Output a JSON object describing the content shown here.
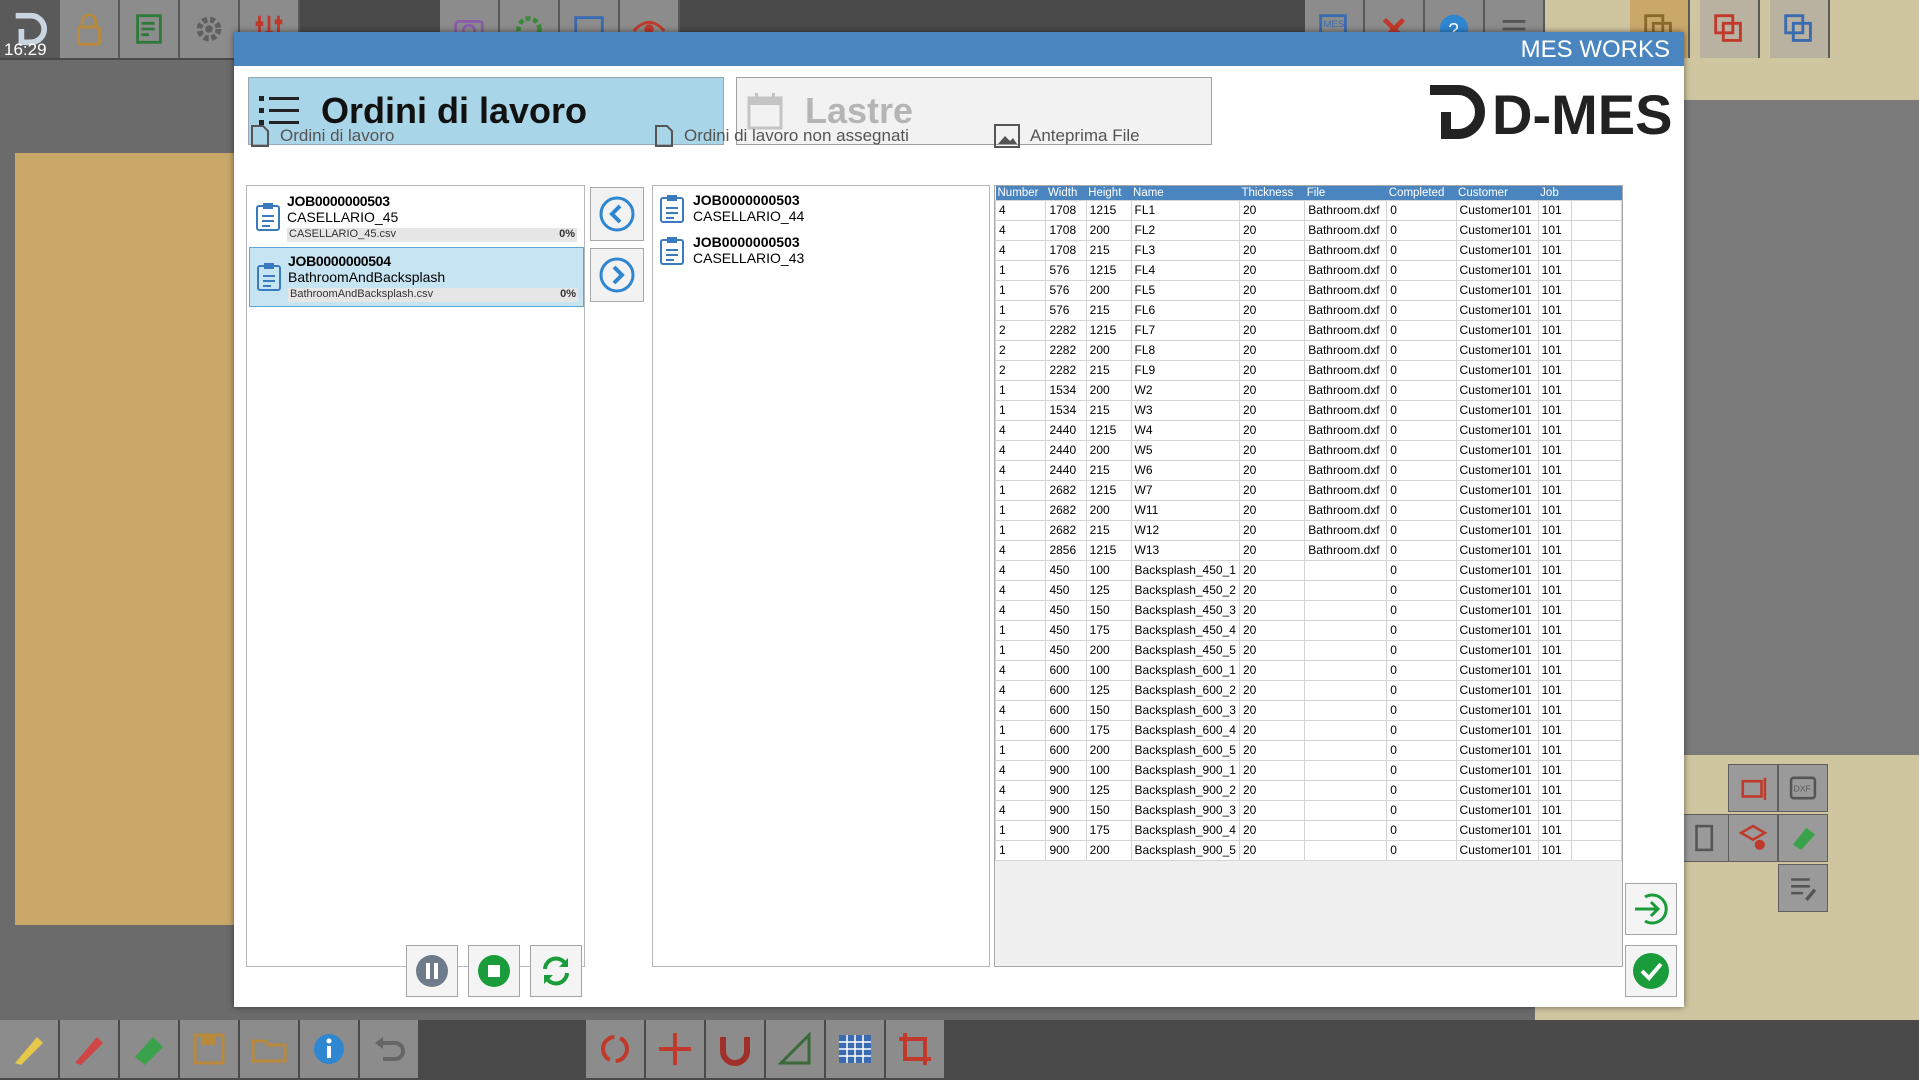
{
  "clock": "16:29",
  "dialog": {
    "title": "MES WORKS",
    "tabs": [
      {
        "label": "Ordini di lavoro",
        "active": true
      },
      {
        "label": "Lastre",
        "active": false
      }
    ],
    "logo": "D-MES"
  },
  "orders_panel": {
    "header": "Ordini di lavoro",
    "jobs": [
      {
        "id": "JOB0000000503",
        "name": "CASELLARIO_45",
        "file": "CASELLARIO_45.csv",
        "progress": "0%",
        "selected": false
      },
      {
        "id": "JOB0000000504",
        "name": "BathroomAndBacksplash",
        "file": "BathroomAndBacksplash.csv",
        "progress": "0%",
        "selected": true
      }
    ]
  },
  "unassigned_panel": {
    "header": "Ordini di lavoro non assegnati",
    "jobs": [
      {
        "id": "JOB0000000503",
        "name": "CASELLARIO_44"
      },
      {
        "id": "JOB0000000503",
        "name": "CASELLARIO_43"
      }
    ]
  },
  "preview_panel": {
    "header": "Anteprima File",
    "columns": [
      "Number",
      "Width",
      "Height",
      "Name",
      "Thickness",
      "File",
      "Completed",
      "Customer",
      "Job"
    ],
    "rows": [
      [
        "4",
        "1708",
        "1215",
        "FL1",
        "20",
        "Bathroom.dxf",
        "0",
        "Customer101",
        "101"
      ],
      [
        "4",
        "1708",
        "200",
        "FL2",
        "20",
        "Bathroom.dxf",
        "0",
        "Customer101",
        "101"
      ],
      [
        "4",
        "1708",
        "215",
        "FL3",
        "20",
        "Bathroom.dxf",
        "0",
        "Customer101",
        "101"
      ],
      [
        "1",
        "576",
        "1215",
        "FL4",
        "20",
        "Bathroom.dxf",
        "0",
        "Customer101",
        "101"
      ],
      [
        "1",
        "576",
        "200",
        "FL5",
        "20",
        "Bathroom.dxf",
        "0",
        "Customer101",
        "101"
      ],
      [
        "1",
        "576",
        "215",
        "FL6",
        "20",
        "Bathroom.dxf",
        "0",
        "Customer101",
        "101"
      ],
      [
        "2",
        "2282",
        "1215",
        "FL7",
        "20",
        "Bathroom.dxf",
        "0",
        "Customer101",
        "101"
      ],
      [
        "2",
        "2282",
        "200",
        "FL8",
        "20",
        "Bathroom.dxf",
        "0",
        "Customer101",
        "101"
      ],
      [
        "2",
        "2282",
        "215",
        "FL9",
        "20",
        "Bathroom.dxf",
        "0",
        "Customer101",
        "101"
      ],
      [
        "1",
        "1534",
        "200",
        "W2",
        "20",
        "Bathroom.dxf",
        "0",
        "Customer101",
        "101"
      ],
      [
        "1",
        "1534",
        "215",
        "W3",
        "20",
        "Bathroom.dxf",
        "0",
        "Customer101",
        "101"
      ],
      [
        "4",
        "2440",
        "1215",
        "W4",
        "20",
        "Bathroom.dxf",
        "0",
        "Customer101",
        "101"
      ],
      [
        "4",
        "2440",
        "200",
        "W5",
        "20",
        "Bathroom.dxf",
        "0",
        "Customer101",
        "101"
      ],
      [
        "4",
        "2440",
        "215",
        "W6",
        "20",
        "Bathroom.dxf",
        "0",
        "Customer101",
        "101"
      ],
      [
        "1",
        "2682",
        "1215",
        "W7",
        "20",
        "Bathroom.dxf",
        "0",
        "Customer101",
        "101"
      ],
      [
        "1",
        "2682",
        "200",
        "W11",
        "20",
        "Bathroom.dxf",
        "0",
        "Customer101",
        "101"
      ],
      [
        "1",
        "2682",
        "215",
        "W12",
        "20",
        "Bathroom.dxf",
        "0",
        "Customer101",
        "101"
      ],
      [
        "4",
        "2856",
        "1215",
        "W13",
        "20",
        "Bathroom.dxf",
        "0",
        "Customer101",
        "101"
      ],
      [
        "4",
        "450",
        "100",
        "Backsplash_450_1",
        "20",
        "",
        "0",
        "Customer101",
        "101"
      ],
      [
        "4",
        "450",
        "125",
        "Backsplash_450_2",
        "20",
        "",
        "0",
        "Customer101",
        "101"
      ],
      [
        "4",
        "450",
        "150",
        "Backsplash_450_3",
        "20",
        "",
        "0",
        "Customer101",
        "101"
      ],
      [
        "1",
        "450",
        "175",
        "Backsplash_450_4",
        "20",
        "",
        "0",
        "Customer101",
        "101"
      ],
      [
        "1",
        "450",
        "200",
        "Backsplash_450_5",
        "20",
        "",
        "0",
        "Customer101",
        "101"
      ],
      [
        "4",
        "600",
        "100",
        "Backsplash_600_1",
        "20",
        "",
        "0",
        "Customer101",
        "101"
      ],
      [
        "4",
        "600",
        "125",
        "Backsplash_600_2",
        "20",
        "",
        "0",
        "Customer101",
        "101"
      ],
      [
        "4",
        "600",
        "150",
        "Backsplash_600_3",
        "20",
        "",
        "0",
        "Customer101",
        "101"
      ],
      [
        "1",
        "600",
        "175",
        "Backsplash_600_4",
        "20",
        "",
        "0",
        "Customer101",
        "101"
      ],
      [
        "1",
        "600",
        "200",
        "Backsplash_600_5",
        "20",
        "",
        "0",
        "Customer101",
        "101"
      ],
      [
        "4",
        "900",
        "100",
        "Backsplash_900_1",
        "20",
        "",
        "0",
        "Customer101",
        "101"
      ],
      [
        "4",
        "900",
        "125",
        "Backsplash_900_2",
        "20",
        "",
        "0",
        "Customer101",
        "101"
      ],
      [
        "4",
        "900",
        "150",
        "Backsplash_900_3",
        "20",
        "",
        "0",
        "Customer101",
        "101"
      ],
      [
        "1",
        "900",
        "175",
        "Backsplash_900_4",
        "20",
        "",
        "0",
        "Customer101",
        "101"
      ],
      [
        "1",
        "900",
        "200",
        "Backsplash_900_5",
        "20",
        "",
        "0",
        "Customer101",
        "101"
      ]
    ]
  },
  "colors": {
    "dialog_header": "#4a85bf",
    "tab_active": "#a9d5e8",
    "accent_green": "#1a9c3a",
    "accent_blue": "#2f86d1"
  },
  "icons": {
    "top_toolbar": [
      "app-logo-icon",
      "lock-icon",
      "checklist-icon",
      "gear-icon",
      "sliders-icon",
      "camera-icon",
      "settings-gear-icon",
      "monitor-icon",
      "eye-icon",
      "mes-icon",
      "tools-icon",
      "help-icon",
      "menu-icon"
    ],
    "bottom_toolbar": [
      "highlighter-icon",
      "marker-icon",
      "eraser-icon",
      "save-icon",
      "folder-icon",
      "info-icon",
      "undo-icon",
      "rotate-icon",
      "move-icon",
      "magnet-icon",
      "measure-icon",
      "grid-icon",
      "crop-icon"
    ]
  }
}
